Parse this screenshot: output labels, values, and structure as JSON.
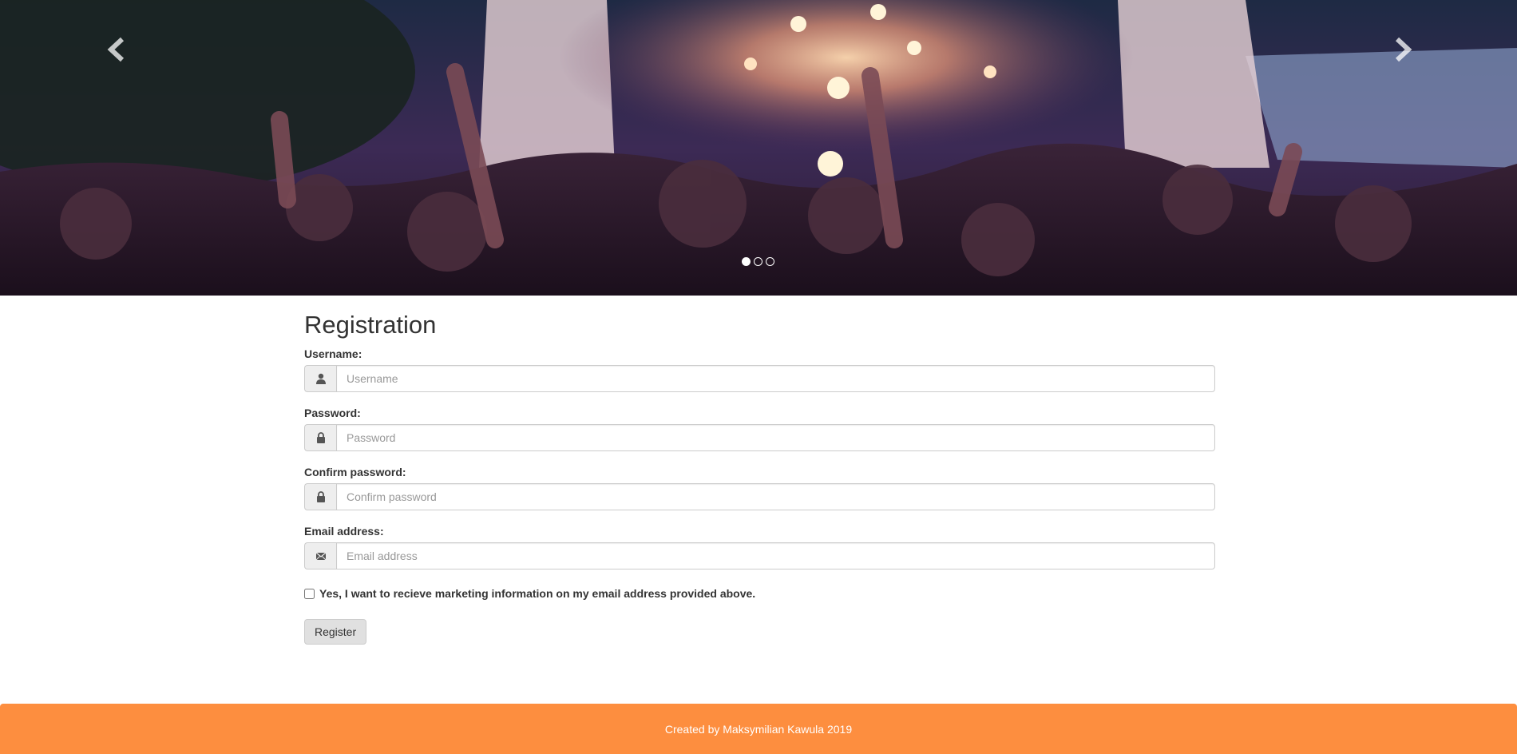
{
  "carousel": {
    "prev_icon": "chevron-left-icon",
    "next_icon": "chevron-right-icon",
    "indicator_count": 3,
    "active_index": 0
  },
  "form": {
    "title": "Registration",
    "username": {
      "label": "Username:",
      "placeholder": "Username",
      "icon": "user-icon"
    },
    "password": {
      "label": "Password:",
      "placeholder": "Password",
      "icon": "lock-icon"
    },
    "confirm_password": {
      "label": "Confirm password:",
      "placeholder": "Confirm password",
      "icon": "lock-icon"
    },
    "email": {
      "label": "Email address:",
      "placeholder": "Email address",
      "icon": "envelope-icon"
    },
    "marketing_checkbox": {
      "label": "Yes, I want to recieve marketing information on my email address provided above.",
      "checked": false
    },
    "submit_label": "Register"
  },
  "footer": {
    "text": "Created by Maksymilian Kawula 2019"
  },
  "colors": {
    "footer_bg": "#fd8e3f",
    "addon_bg": "#eeeeee",
    "button_bg": "#e0e0e0"
  }
}
